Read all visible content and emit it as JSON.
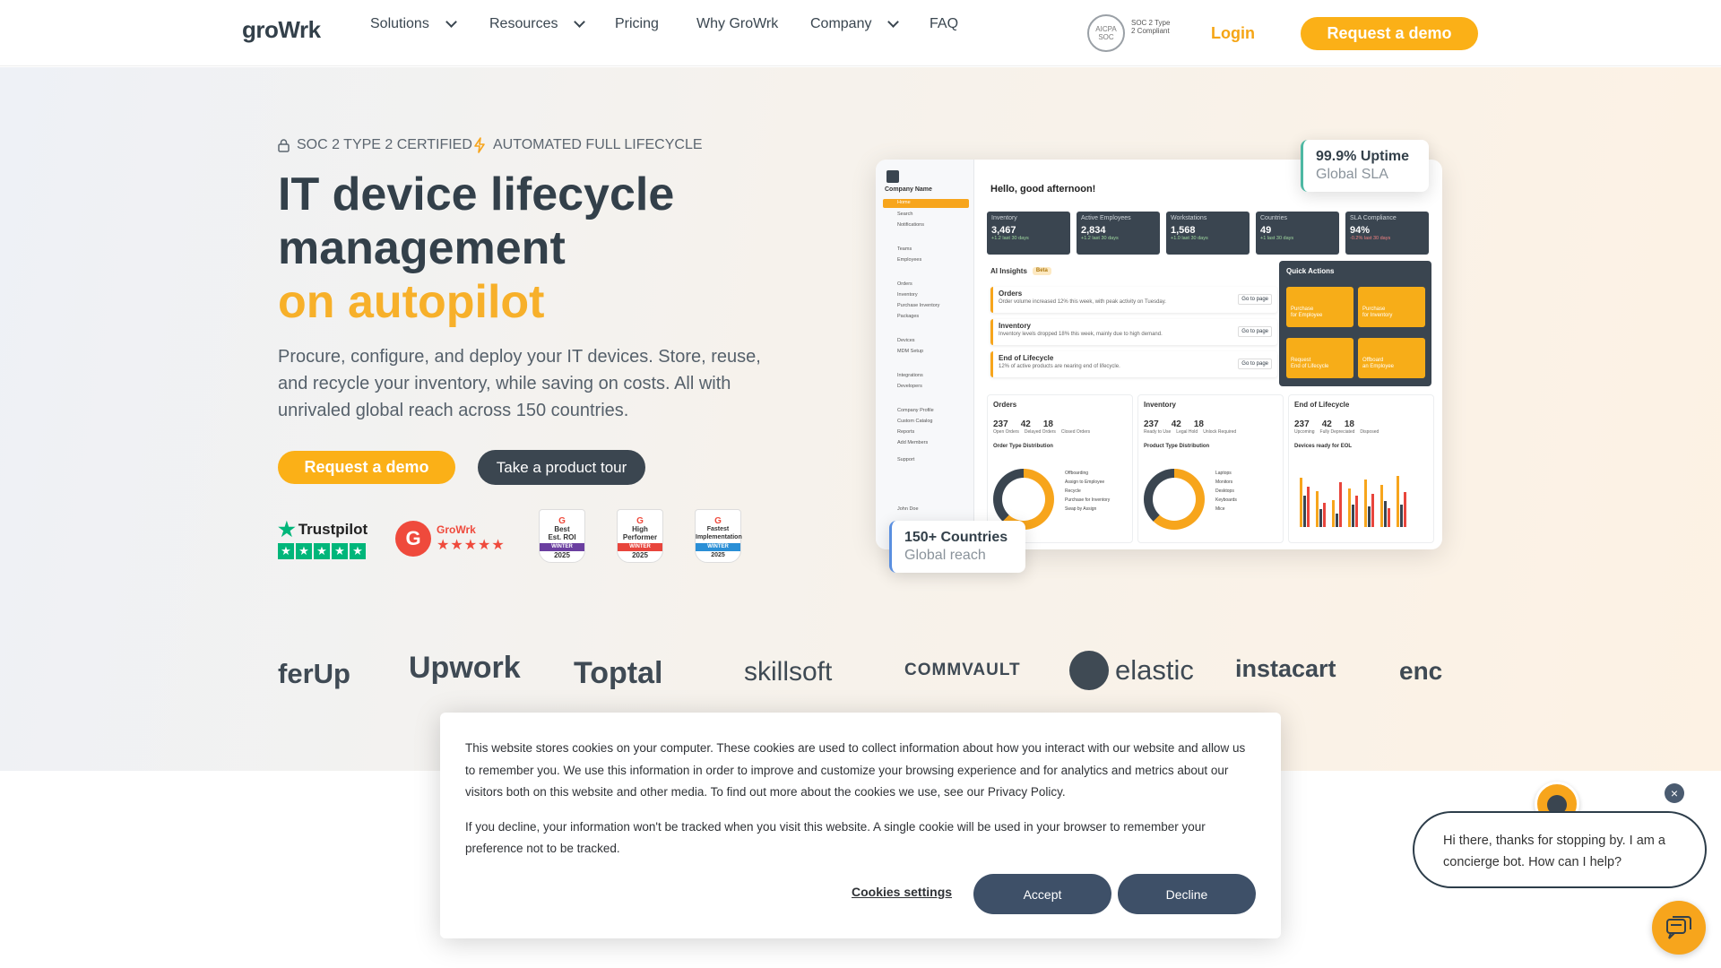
{
  "header": {
    "logo_text": "groWrk",
    "nav": [
      {
        "label": "Solutions",
        "dropdown": true
      },
      {
        "label": "Resources",
        "dropdown": true
      },
      {
        "label": "Pricing",
        "dropdown": false
      },
      {
        "label": "Why GroWrk",
        "dropdown": false
      },
      {
        "label": "Company",
        "dropdown": true
      },
      {
        "label": "FAQ",
        "dropdown": false
      }
    ],
    "aicpa_seal": "AICPA SOC",
    "soc_badge": "SOC 2 Type 2 Compliant",
    "login": "Login",
    "cta": "Request a demo"
  },
  "hero": {
    "badges": [
      "SOC 2 TYPE 2 CERTIFIED",
      "AUTOMATED FULL LIFECYCLE"
    ],
    "title_line1": "IT device lifecycle",
    "title_line2": "management",
    "title_highlight": "on autopilot",
    "subtitle": "Procure, configure, and deploy your IT devices. Store, reuse, and recycle your inventory, while saving on costs. All with unrivaled global reach across 150 countries.",
    "cta_primary": "Request a demo",
    "cta_secondary": "Take a product tour",
    "trust": {
      "trustpilot": "Trustpilot",
      "g2_name": "GroWrk",
      "g2_badges": [
        {
          "line1": "Best",
          "line2": "Est. ROI",
          "season": "WINTER",
          "year": "2025",
          "color": "#6b3fa0"
        },
        {
          "line1": "High",
          "line2": "Performer",
          "season": "WINTER",
          "year": "2025",
          "color": "#e8453c"
        },
        {
          "line1": "Fastest",
          "line2": "Implementation",
          "season": "WINTER",
          "year": "2025",
          "color": "#2a8fd6"
        }
      ]
    }
  },
  "dashboard": {
    "company": "Company Name",
    "greeting": "Hello, good afternoon!",
    "sidebar": [
      "Home",
      "Search",
      "Notifications",
      "Teams",
      "Employees",
      "Orders",
      "Inventory",
      "Purchase Inventory",
      "Packages",
      "Devices",
      "MDM Setup",
      "Integrations",
      "Developers",
      "Company Profile",
      "Custom Catalog",
      "Reports",
      "Add Members",
      "Support"
    ],
    "user": "John Doe",
    "kpis": [
      {
        "label": "Inventory",
        "value": "3,467",
        "sub": "+1.2 last 30 days"
      },
      {
        "label": "Active Employees",
        "value": "2,834",
        "sub": "+1.2 last 30 days"
      },
      {
        "label": "Workstations",
        "value": "1,568",
        "sub": "+1.0 last 30 days"
      },
      {
        "label": "Countries",
        "value": "49",
        "sub": "+1 last 30 days"
      },
      {
        "label": "SLA Compliance",
        "value": "94%",
        "sub": "-0.2% last 30 days"
      }
    ],
    "insights_title": "AI Insights",
    "insights_tag": "Beta",
    "insights": [
      {
        "title": "Orders",
        "desc": "Order volume increased 12% this week, with peak activity on Tuesday.",
        "action": "Go to page"
      },
      {
        "title": "Inventory",
        "desc": "Inventory levels dropped 18% this week, mainly due to high demand.",
        "action": "Go to page"
      },
      {
        "title": "End of Lifecycle",
        "desc": "12% of active products are nearing end of lifecycle.",
        "action": "Go to page"
      }
    ],
    "quick_actions_title": "Quick Actions",
    "quick_actions": [
      {
        "label": "Purchase",
        "sub": "for Employee"
      },
      {
        "label": "Purchase",
        "sub": "for Inventory"
      },
      {
        "label": "Request",
        "sub": "End of Lifecycle"
      },
      {
        "label": "Offboard",
        "sub": "an Employee"
      }
    ],
    "cards": [
      {
        "title": "Orders",
        "nums": [
          "237",
          "42",
          "18"
        ],
        "labels": [
          "Open Orders",
          "Delayed Orders",
          "Closed Orders"
        ],
        "chart_title": "Order Type Distribution",
        "legend": [
          "Offboarding",
          "Assign to Employee",
          "Recycle",
          "Purchase for Inventory",
          "Swap by Assign"
        ]
      },
      {
        "title": "Inventory",
        "nums": [
          "237",
          "42",
          "18"
        ],
        "labels": [
          "Ready to Use",
          "Legal Hold",
          "Unlock Required"
        ],
        "chart_title": "Product Type Distribution",
        "legend": [
          "Laptops",
          "Monitors",
          "Desktops",
          "Keyboards",
          "Mice"
        ]
      },
      {
        "title": "End of Lifecycle",
        "nums": [
          "237",
          "42",
          "18"
        ],
        "labels": [
          "Upcoming",
          "Fully Depreciated",
          "Disposed"
        ],
        "chart_title": "Devices ready for EOL",
        "legend": []
      }
    ],
    "float_uptime_title": "99.9% Uptime",
    "float_uptime_sub": "Global SLA",
    "float_countries_title": "150+ Countries",
    "float_countries_sub": "Global reach"
  },
  "logos": [
    "ferUp",
    "Upwork",
    "Toptal",
    "skillsoft",
    "COMMVAULT",
    "elastic",
    "instacart",
    "enc"
  ],
  "cookie": {
    "p1": "This website stores cookies on your computer. These cookies are used to collect information about how you interact with our website and allow us to remember you. We use this information in order to improve and customize your browsing experience and for analytics and metrics about our visitors both on this website and other media. To find out more about the cookies we use, see our Privacy Policy.",
    "p2": "If you decline, your information won't be tracked when you visit this website. A single cookie will be used in your browser to remember your preference not to be tracked.",
    "settings": "Cookies settings",
    "accept": "Accept",
    "decline": "Decline"
  },
  "chat": {
    "message": "Hi there, thanks for stopping by. I am a concierge bot. How can I help?"
  },
  "colors": {
    "accent": "#fbb017",
    "dark": "#3a4550",
    "cookie_btn": "#3e5068"
  }
}
